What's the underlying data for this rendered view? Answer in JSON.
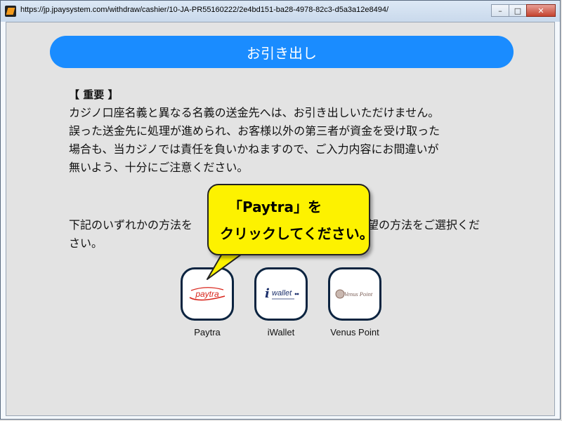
{
  "window": {
    "url": "https://jp.jpaysystem.com/withdraw/cashier/10-JA-PR55160222/2e4bd151-ba28-4978-82c3-d5a3a12e8494/",
    "controls": {
      "minimize": "–",
      "maximize": "□",
      "close": "✕"
    }
  },
  "page": {
    "title": "お引き出し",
    "notice": {
      "heading": "【 重要 】",
      "lines": [
        "カジノ口座名義と異なる名義の送金先へは、お引き出しいただけません。",
        "誤った送金先に処理が進められ、お客様以外の第三者が資金を受け取った",
        "場合も、当カジノでは責任を負いかねますので、ご入力内容にお間違いが",
        "無いよう、十分にご注意ください。"
      ]
    },
    "instruction": {
      "line1_left": "下記のいずれかの方法を",
      "line1_right": "望の方法をご選択くだ",
      "line2": "さい。"
    }
  },
  "methods": [
    {
      "label": "Paytra",
      "logo_text": "paytra",
      "icon": "paytra-logo-icon"
    },
    {
      "label": "iWallet",
      "logo_text": "wallet",
      "icon": "iwallet-logo-icon"
    },
    {
      "label": "Venus Point",
      "logo_text": "Venus Point",
      "icon": "venus-point-logo-icon"
    }
  ],
  "callout": {
    "line1": "「Paytra」を",
    "line2": "クリックしてください。",
    "color": "#fdf200"
  },
  "colors": {
    "header": "#1a8cff",
    "tile_border": "#0c2440",
    "paytra_red": "#d9261c",
    "iwallet_navy": "#1b2f6b"
  }
}
